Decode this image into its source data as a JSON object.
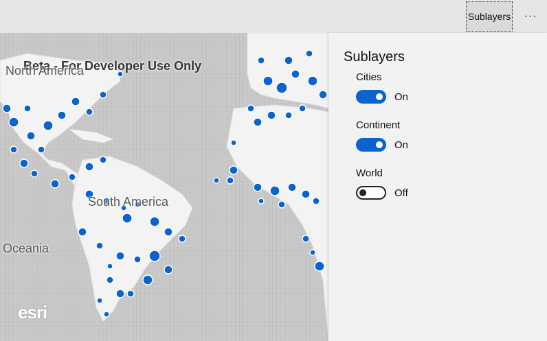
{
  "toolbar": {
    "sublayers_button": "Sublayers",
    "more_button": "···"
  },
  "map": {
    "watermark": "Beta - For Developer Use Only",
    "labels": {
      "north_america": "North America",
      "south_america": "South America",
      "oceania": "Oceania"
    },
    "attribution_logo": "esri",
    "basemap_color": "#c9c9c9",
    "point_color": "#0b63ce"
  },
  "panel": {
    "title": "Sublayers",
    "layers": [
      {
        "name": "Cities",
        "state": "On",
        "enabled": true
      },
      {
        "name": "Continent",
        "state": "On",
        "enabled": true
      },
      {
        "name": "World",
        "state": "Off",
        "enabled": false
      }
    ]
  },
  "colors": {
    "accent": "#0b63ce",
    "panel_bg": "#f2f2f2",
    "toolbar_bg": "#e6e6e6"
  }
}
